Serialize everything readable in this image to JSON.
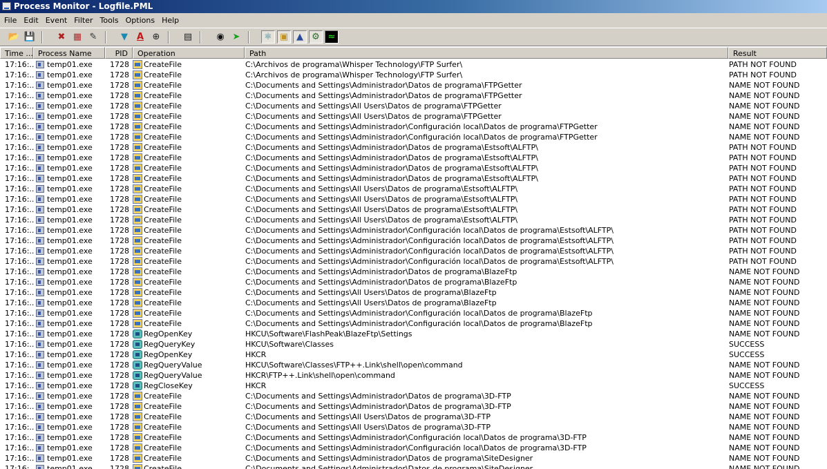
{
  "window": {
    "title": "Process Monitor - Logfile.PML"
  },
  "menu": [
    "File",
    "Edit",
    "Event",
    "Filter",
    "Tools",
    "Options",
    "Help"
  ],
  "toolbar": {
    "icons": [
      "open-icon",
      "save-icon",
      "capture-icon",
      "autoscroll-icon",
      "clear-icon",
      "filter-icon",
      "highlight-icon",
      "target-icon",
      "process-tree-icon",
      "find-icon",
      "jump-icon",
      "registry-activity-icon",
      "file-activity-icon",
      "network-activity-icon",
      "process-activity-icon",
      "profiling-icon"
    ]
  },
  "columns": {
    "time": "Time ...",
    "process": "Process Name",
    "pid": "PID",
    "operation": "Operation",
    "path": "Path",
    "result": "Result"
  },
  "rows": [
    {
      "time": "17:16:...",
      "process": "temp01.exe",
      "pid": "1728",
      "op": "CreateFile",
      "kind": "fs",
      "path": "C:\\Archivos de programa\\Whisper Technology\\FTP Surfer\\",
      "result": "PATH NOT FOUND"
    },
    {
      "time": "17:16:...",
      "process": "temp01.exe",
      "pid": "1728",
      "op": "CreateFile",
      "kind": "fs",
      "path": "C:\\Archivos de programa\\Whisper Technology\\FTP Surfer\\",
      "result": "PATH NOT FOUND"
    },
    {
      "time": "17:16:...",
      "process": "temp01.exe",
      "pid": "1728",
      "op": "CreateFile",
      "kind": "fs",
      "path": "C:\\Documents and Settings\\Administrador\\Datos de programa\\FTPGetter",
      "result": "NAME NOT FOUND"
    },
    {
      "time": "17:16:...",
      "process": "temp01.exe",
      "pid": "1728",
      "op": "CreateFile",
      "kind": "fs",
      "path": "C:\\Documents and Settings\\Administrador\\Datos de programa\\FTPGetter",
      "result": "NAME NOT FOUND"
    },
    {
      "time": "17:16:...",
      "process": "temp01.exe",
      "pid": "1728",
      "op": "CreateFile",
      "kind": "fs",
      "path": "C:\\Documents and Settings\\All Users\\Datos de programa\\FTPGetter",
      "result": "NAME NOT FOUND"
    },
    {
      "time": "17:16:...",
      "process": "temp01.exe",
      "pid": "1728",
      "op": "CreateFile",
      "kind": "fs",
      "path": "C:\\Documents and Settings\\All Users\\Datos de programa\\FTPGetter",
      "result": "NAME NOT FOUND"
    },
    {
      "time": "17:16:...",
      "process": "temp01.exe",
      "pid": "1728",
      "op": "CreateFile",
      "kind": "fs",
      "path": "C:\\Documents and Settings\\Administrador\\Configuración local\\Datos de programa\\FTPGetter",
      "result": "NAME NOT FOUND"
    },
    {
      "time": "17:16:...",
      "process": "temp01.exe",
      "pid": "1728",
      "op": "CreateFile",
      "kind": "fs",
      "path": "C:\\Documents and Settings\\Administrador\\Configuración local\\Datos de programa\\FTPGetter",
      "result": "NAME NOT FOUND"
    },
    {
      "time": "17:16:...",
      "process": "temp01.exe",
      "pid": "1728",
      "op": "CreateFile",
      "kind": "fs",
      "path": "C:\\Documents and Settings\\Administrador\\Datos de programa\\Estsoft\\ALFTP\\",
      "result": "PATH NOT FOUND"
    },
    {
      "time": "17:16:...",
      "process": "temp01.exe",
      "pid": "1728",
      "op": "CreateFile",
      "kind": "fs",
      "path": "C:\\Documents and Settings\\Administrador\\Datos de programa\\Estsoft\\ALFTP\\",
      "result": "PATH NOT FOUND"
    },
    {
      "time": "17:16:...",
      "process": "temp01.exe",
      "pid": "1728",
      "op": "CreateFile",
      "kind": "fs",
      "path": "C:\\Documents and Settings\\Administrador\\Datos de programa\\Estsoft\\ALFTP\\",
      "result": "PATH NOT FOUND"
    },
    {
      "time": "17:16:...",
      "process": "temp01.exe",
      "pid": "1728",
      "op": "CreateFile",
      "kind": "fs",
      "path": "C:\\Documents and Settings\\Administrador\\Datos de programa\\Estsoft\\ALFTP\\",
      "result": "PATH NOT FOUND"
    },
    {
      "time": "17:16:...",
      "process": "temp01.exe",
      "pid": "1728",
      "op": "CreateFile",
      "kind": "fs",
      "path": "C:\\Documents and Settings\\All Users\\Datos de programa\\Estsoft\\ALFTP\\",
      "result": "PATH NOT FOUND"
    },
    {
      "time": "17:16:...",
      "process": "temp01.exe",
      "pid": "1728",
      "op": "CreateFile",
      "kind": "fs",
      "path": "C:\\Documents and Settings\\All Users\\Datos de programa\\Estsoft\\ALFTP\\",
      "result": "PATH NOT FOUND"
    },
    {
      "time": "17:16:...",
      "process": "temp01.exe",
      "pid": "1728",
      "op": "CreateFile",
      "kind": "fs",
      "path": "C:\\Documents and Settings\\All Users\\Datos de programa\\Estsoft\\ALFTP\\",
      "result": "PATH NOT FOUND"
    },
    {
      "time": "17:16:...",
      "process": "temp01.exe",
      "pid": "1728",
      "op": "CreateFile",
      "kind": "fs",
      "path": "C:\\Documents and Settings\\All Users\\Datos de programa\\Estsoft\\ALFTP\\",
      "result": "PATH NOT FOUND"
    },
    {
      "time": "17:16:...",
      "process": "temp01.exe",
      "pid": "1728",
      "op": "CreateFile",
      "kind": "fs",
      "path": "C:\\Documents and Settings\\Administrador\\Configuración local\\Datos de programa\\Estsoft\\ALFTP\\",
      "result": "PATH NOT FOUND"
    },
    {
      "time": "17:16:...",
      "process": "temp01.exe",
      "pid": "1728",
      "op": "CreateFile",
      "kind": "fs",
      "path": "C:\\Documents and Settings\\Administrador\\Configuración local\\Datos de programa\\Estsoft\\ALFTP\\",
      "result": "PATH NOT FOUND"
    },
    {
      "time": "17:16:...",
      "process": "temp01.exe",
      "pid": "1728",
      "op": "CreateFile",
      "kind": "fs",
      "path": "C:\\Documents and Settings\\Administrador\\Configuración local\\Datos de programa\\Estsoft\\ALFTP\\",
      "result": "PATH NOT FOUND"
    },
    {
      "time": "17:16:...",
      "process": "temp01.exe",
      "pid": "1728",
      "op": "CreateFile",
      "kind": "fs",
      "path": "C:\\Documents and Settings\\Administrador\\Configuración local\\Datos de programa\\Estsoft\\ALFTP\\",
      "result": "PATH NOT FOUND"
    },
    {
      "time": "17:16:...",
      "process": "temp01.exe",
      "pid": "1728",
      "op": "CreateFile",
      "kind": "fs",
      "path": "C:\\Documents and Settings\\Administrador\\Datos de programa\\BlazeFtp",
      "result": "NAME NOT FOUND"
    },
    {
      "time": "17:16:...",
      "process": "temp01.exe",
      "pid": "1728",
      "op": "CreateFile",
      "kind": "fs",
      "path": "C:\\Documents and Settings\\Administrador\\Datos de programa\\BlazeFtp",
      "result": "NAME NOT FOUND"
    },
    {
      "time": "17:16:...",
      "process": "temp01.exe",
      "pid": "1728",
      "op": "CreateFile",
      "kind": "fs",
      "path": "C:\\Documents and Settings\\All Users\\Datos de programa\\BlazeFtp",
      "result": "NAME NOT FOUND"
    },
    {
      "time": "17:16:...",
      "process": "temp01.exe",
      "pid": "1728",
      "op": "CreateFile",
      "kind": "fs",
      "path": "C:\\Documents and Settings\\All Users\\Datos de programa\\BlazeFtp",
      "result": "NAME NOT FOUND"
    },
    {
      "time": "17:16:...",
      "process": "temp01.exe",
      "pid": "1728",
      "op": "CreateFile",
      "kind": "fs",
      "path": "C:\\Documents and Settings\\Administrador\\Configuración local\\Datos de programa\\BlazeFtp",
      "result": "NAME NOT FOUND"
    },
    {
      "time": "17:16:...",
      "process": "temp01.exe",
      "pid": "1728",
      "op": "CreateFile",
      "kind": "fs",
      "path": "C:\\Documents and Settings\\Administrador\\Configuración local\\Datos de programa\\BlazeFtp",
      "result": "NAME NOT FOUND"
    },
    {
      "time": "17:16:...",
      "process": "temp01.exe",
      "pid": "1728",
      "op": "RegOpenKey",
      "kind": "reg",
      "path": "HKCU\\Software\\FlashPeak\\BlazeFtp\\Settings",
      "result": "NAME NOT FOUND"
    },
    {
      "time": "17:16:...",
      "process": "temp01.exe",
      "pid": "1728",
      "op": "RegQueryKey",
      "kind": "reg",
      "path": "HKCU\\Software\\Classes",
      "result": "SUCCESS"
    },
    {
      "time": "17:16:...",
      "process": "temp01.exe",
      "pid": "1728",
      "op": "RegOpenKey",
      "kind": "reg",
      "path": "HKCR",
      "result": "SUCCESS"
    },
    {
      "time": "17:16:...",
      "process": "temp01.exe",
      "pid": "1728",
      "op": "RegQueryValue",
      "kind": "reg",
      "path": "HKCU\\Software\\Classes\\FTP++.Link\\shell\\open\\command",
      "result": "NAME NOT FOUND"
    },
    {
      "time": "17:16:...",
      "process": "temp01.exe",
      "pid": "1728",
      "op": "RegQueryValue",
      "kind": "reg",
      "path": "HKCR\\FTP++.Link\\shell\\open\\command",
      "result": "NAME NOT FOUND"
    },
    {
      "time": "17:16:...",
      "process": "temp01.exe",
      "pid": "1728",
      "op": "RegCloseKey",
      "kind": "reg",
      "path": "HKCR",
      "result": "SUCCESS"
    },
    {
      "time": "17:16:...",
      "process": "temp01.exe",
      "pid": "1728",
      "op": "CreateFile",
      "kind": "fs",
      "path": "C:\\Documents and Settings\\Administrador\\Datos de programa\\3D-FTP",
      "result": "NAME NOT FOUND"
    },
    {
      "time": "17:16:...",
      "process": "temp01.exe",
      "pid": "1728",
      "op": "CreateFile",
      "kind": "fs",
      "path": "C:\\Documents and Settings\\Administrador\\Datos de programa\\3D-FTP",
      "result": "NAME NOT FOUND"
    },
    {
      "time": "17:16:...",
      "process": "temp01.exe",
      "pid": "1728",
      "op": "CreateFile",
      "kind": "fs",
      "path": "C:\\Documents and Settings\\All Users\\Datos de programa\\3D-FTP",
      "result": "NAME NOT FOUND"
    },
    {
      "time": "17:16:...",
      "process": "temp01.exe",
      "pid": "1728",
      "op": "CreateFile",
      "kind": "fs",
      "path": "C:\\Documents and Settings\\All Users\\Datos de programa\\3D-FTP",
      "result": "NAME NOT FOUND"
    },
    {
      "time": "17:16:...",
      "process": "temp01.exe",
      "pid": "1728",
      "op": "CreateFile",
      "kind": "fs",
      "path": "C:\\Documents and Settings\\Administrador\\Configuración local\\Datos de programa\\3D-FTP",
      "result": "NAME NOT FOUND"
    },
    {
      "time": "17:16:...",
      "process": "temp01.exe",
      "pid": "1728",
      "op": "CreateFile",
      "kind": "fs",
      "path": "C:\\Documents and Settings\\Administrador\\Configuración local\\Datos de programa\\3D-FTP",
      "result": "NAME NOT FOUND"
    },
    {
      "time": "17:16:...",
      "process": "temp01.exe",
      "pid": "1728",
      "op": "CreateFile",
      "kind": "fs",
      "path": "C:\\Documents and Settings\\Administrador\\Datos de programa\\SiteDesigner",
      "result": "NAME NOT FOUND"
    },
    {
      "time": "17:16:...",
      "process": "temp01.exe",
      "pid": "1728",
      "op": "CreateFile",
      "kind": "fs",
      "path": "C:\\Documents and Settings\\Administrador\\Datos de programa\\SiteDesigner",
      "result": "NAME NOT FOUND"
    }
  ]
}
